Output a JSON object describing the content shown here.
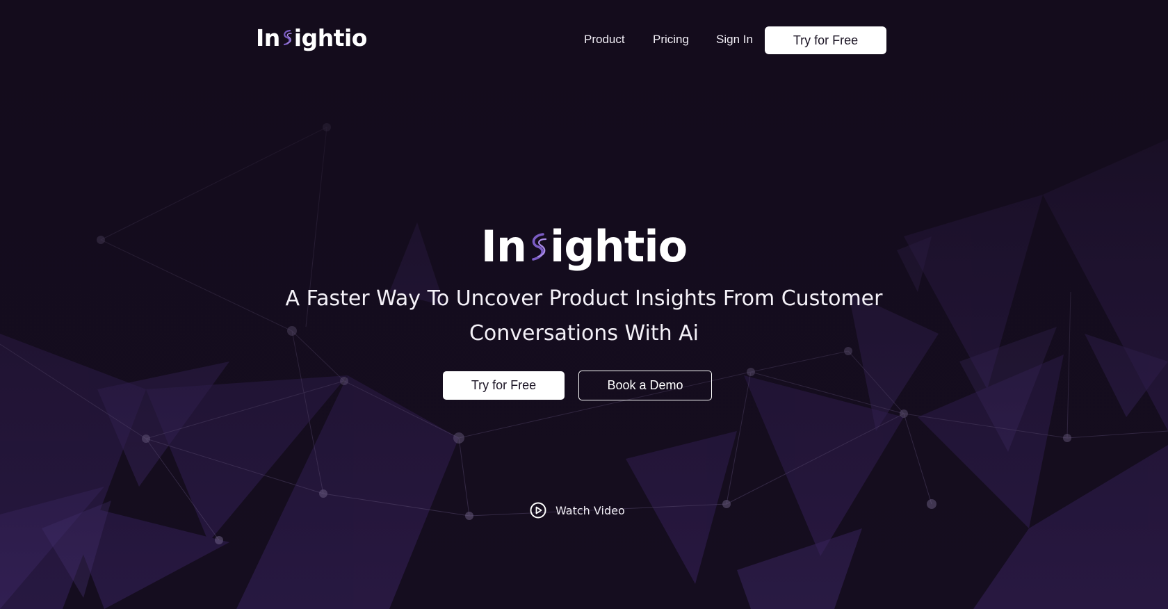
{
  "brand": {
    "logo_text_before": "In",
    "logo_text_after": "ightio"
  },
  "nav": {
    "items": [
      {
        "label": "Product"
      },
      {
        "label": "Pricing"
      },
      {
        "label": "Sign In"
      }
    ],
    "cta_label": "Try for Free"
  },
  "hero": {
    "tagline_line1": "A Faster Way To Uncover Product Insights From Customer",
    "tagline_line2": "Conversations With Ai",
    "primary_cta": "Try for Free",
    "secondary_cta": "Book a Demo",
    "watch_video_label": "Watch Video"
  },
  "icons": {
    "play": "play-circle-icon",
    "logo_mark": "fingerprint-s-icon"
  },
  "colors": {
    "background": "#140c1c",
    "accent": "#7b5cc4",
    "button_bg": "#ffffff",
    "button_text": "#1b1424"
  }
}
